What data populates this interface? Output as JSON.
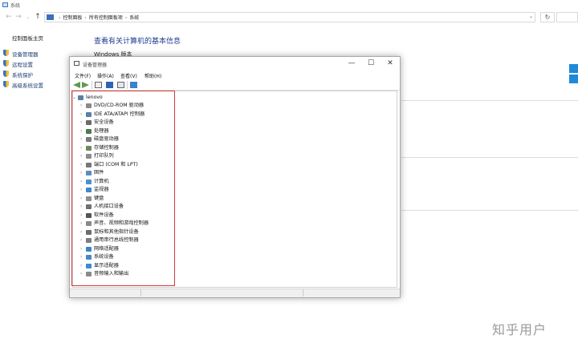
{
  "background_window": {
    "title": "系统",
    "breadcrumb": [
      "控制面板",
      "所有控制面板项",
      "系统"
    ],
    "nav_back": "←",
    "nav_forward": "→",
    "nav_recent": "⌄",
    "nav_up": "↑",
    "address_dropdown": "⌄",
    "refresh": "↻",
    "left_home": "控制面板主页",
    "left_links": [
      "设备管理器",
      "远程设置",
      "系统保护",
      "高级系统设置"
    ],
    "heading": "查看有关计算机的基本信息",
    "windows_version_label": "Windows 版本"
  },
  "device_manager": {
    "title": "设备管理器",
    "window_buttons": {
      "minimize": "—",
      "maximize": "☐",
      "close": "✕"
    },
    "menu": [
      "文件(F)",
      "操作(A)",
      "查看(V)",
      "帮助(H)"
    ],
    "toolbar_icons": [
      "back-icon",
      "forward-icon",
      "properties-icon",
      "help-icon",
      "scan-icon",
      "monitor-icon"
    ],
    "root": {
      "expander": "⌄",
      "label": "lenovo"
    },
    "expander_collapsed": "›",
    "categories": [
      {
        "label": "DVD/CD-ROM 驱动器",
        "color": "#8a8a8a"
      },
      {
        "label": "IDE ATA/ATAPI 控制器",
        "color": "#5a7fa8"
      },
      {
        "label": "安全设备",
        "color": "#6b6b6b"
      },
      {
        "label": "处理器",
        "color": "#4d7a4d"
      },
      {
        "label": "磁盘驱动器",
        "color": "#7a7a7a"
      },
      {
        "label": "存储控制器",
        "color": "#6a8a5a"
      },
      {
        "label": "打印队列",
        "color": "#8c8c8c"
      },
      {
        "label": "端口 (COM 和 LPT)",
        "color": "#777777"
      },
      {
        "label": "固件",
        "color": "#5c8dc0"
      },
      {
        "label": "计算机",
        "color": "#4d8fd6"
      },
      {
        "label": "监视器",
        "color": "#3f88d0"
      },
      {
        "label": "键盘",
        "color": "#8f8f8f"
      },
      {
        "label": "人机接口设备",
        "color": "#707070"
      },
      {
        "label": "软件设备",
        "color": "#555555"
      },
      {
        "label": "声音、视频和游戏控制器",
        "color": "#8a8a8a"
      },
      {
        "label": "鼠标和其他指针设备",
        "color": "#6d6d6d"
      },
      {
        "label": "通用串行总线控制器",
        "color": "#7d7d7d"
      },
      {
        "label": "网络适配器",
        "color": "#3d83c9"
      },
      {
        "label": "系统设备",
        "color": "#4a86c2"
      },
      {
        "label": "显示适配器",
        "color": "#3e8ad2"
      },
      {
        "label": "音频输入和输出",
        "color": "#8a8a8a"
      }
    ]
  },
  "watermark": "知乎用户"
}
